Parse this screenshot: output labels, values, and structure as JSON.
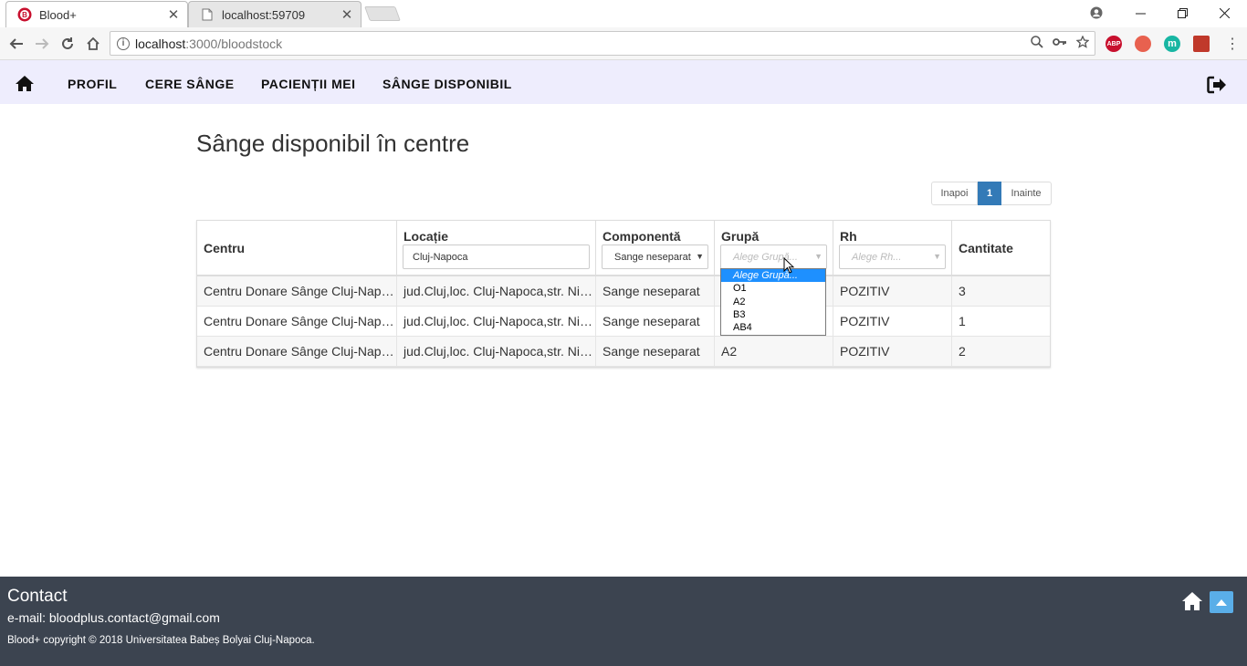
{
  "browser": {
    "tabs": [
      {
        "title": "Blood+",
        "active": true
      },
      {
        "title": "localhost:59709",
        "active": false
      }
    ],
    "url_host": "localhost",
    "url_rest": ":3000/bloodstock",
    "extensions": [
      {
        "name": "adblock-plus-icon",
        "label": "ABP",
        "color": "#c8102e"
      },
      {
        "name": "extension-red-icon",
        "label": "",
        "color": "#e8614f"
      },
      {
        "name": "extension-teal-icon",
        "label": "m",
        "color": "#18b6a3"
      },
      {
        "name": "extension-puzzle-icon",
        "label": "",
        "color": "#c0392b"
      }
    ]
  },
  "nav": {
    "links": [
      "PROFIL",
      "CERE SÂNGE",
      "PACIENȚII MEI",
      "SÂNGE DISPONIBIL"
    ]
  },
  "page": {
    "title": "Sânge disponibil în centre"
  },
  "pagination": {
    "prev": "Inapoi",
    "current": "1",
    "next": "Inainte"
  },
  "table": {
    "columns": [
      "Centru",
      "Locație",
      "Componentă",
      "Grupă",
      "Rh",
      "Cantitate"
    ],
    "filters": {
      "locatie_value": "Cluj-Napoca",
      "componenta_value": "Sange neseparat",
      "grupa_placeholder": "Alege Grupă...",
      "rh_placeholder": "Alege Rh..."
    },
    "rows": [
      [
        "Centru Donare Sânge Cluj-Napoca",
        "jud.Cluj,loc. Cluj-Napoca,str. Nicolae Bălcescu",
        "Sange neseparat",
        "",
        "POZITIV",
        "3"
      ],
      [
        "Centru Donare Sânge Cluj-Napoca",
        "jud.Cluj,loc. Cluj-Napoca,str. Nicolae Bălcescu",
        "Sange neseparat",
        "",
        "POZITIV",
        "1"
      ],
      [
        "Centru Donare Sânge Cluj-Napoca",
        "jud.Cluj,loc. Cluj-Napoca,str. Nicolae Bălcescu",
        "Sange neseparat",
        "A2",
        "POZITIV",
        "2"
      ]
    ],
    "grupa_dropdown_options": [
      "Alege Grupă...",
      "O1",
      "A2",
      "B3",
      "AB4"
    ]
  },
  "footer": {
    "title": "Contact",
    "email": "e-mail: bloodplus.contact@gmail.com",
    "copyright": "Blood+ copyright © 2018 Universitatea Babeș Bolyai Cluj-Napoca."
  },
  "colors": {
    "navbar_bg": "#eeedfd",
    "footer_bg": "#3c4450",
    "pager_active": "#337ab7",
    "dropdown_selected": "#1e90ff"
  }
}
